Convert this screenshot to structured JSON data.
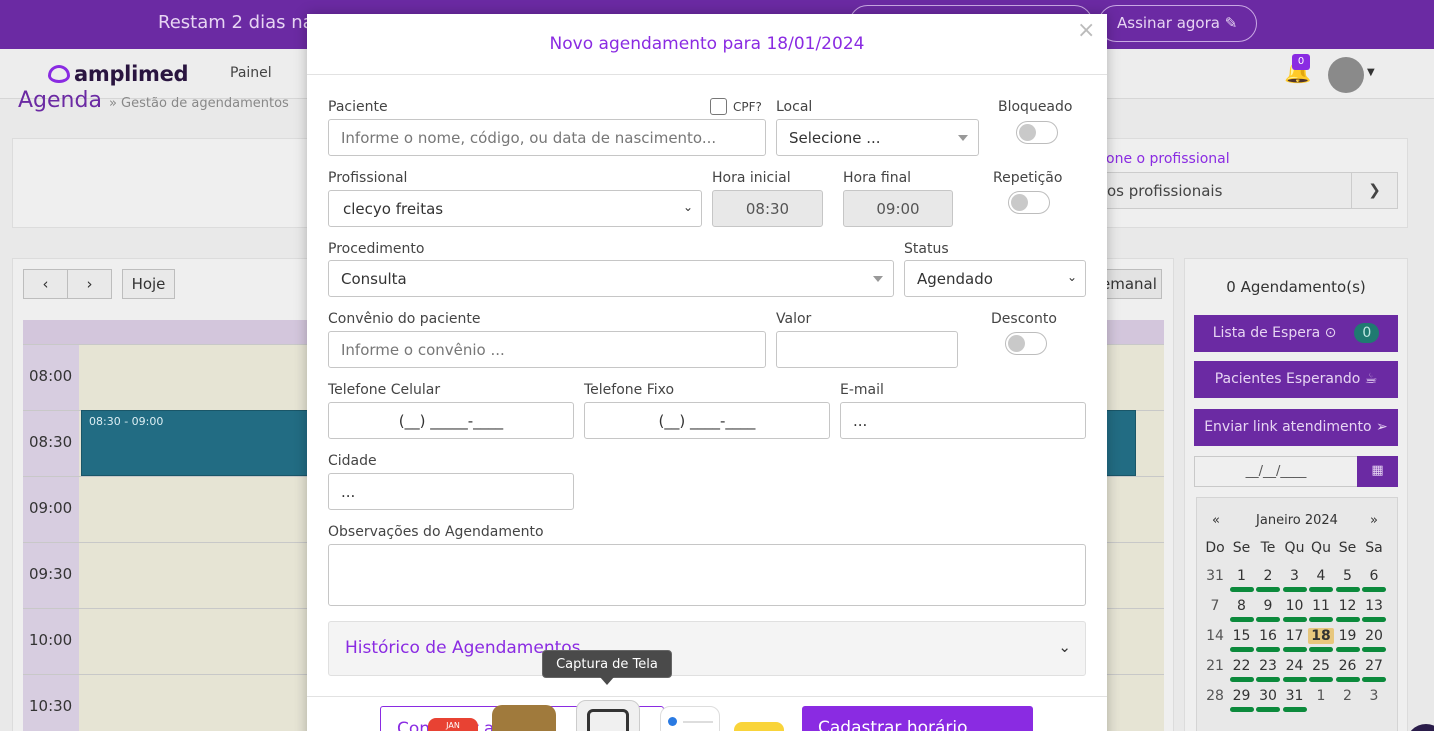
{
  "banner": {
    "trial_text": "Restam 2 dias na",
    "subscribe_label": "Assinar agora ✎",
    "other_label": ""
  },
  "nav": {
    "logo": "amplimed",
    "painel": "Painel",
    "notifications_count": "0"
  },
  "page": {
    "title": "Agenda",
    "subtitle": "» Gestão de agendamentos"
  },
  "filter": {
    "label": "one o profissional",
    "value": "os profissionais"
  },
  "calendar": {
    "prev": "‹",
    "next": "›",
    "today": "Hoje",
    "view": "emanal",
    "times": [
      "08:00",
      "08:30",
      "09:00",
      "09:30",
      "10:00",
      "10:30"
    ],
    "appointment_time": "08:30 - 09:00"
  },
  "sidebar": {
    "count": "0 Agendamento(s)",
    "wait_list": "Lista de Espera ⊙",
    "wait_count": "0",
    "waiting_patients": "Pacientes Esperando ☕",
    "send_link": "Enviar link atendimento ➢",
    "date_placeholder": "__/__/____",
    "mini_cal": {
      "prev": "«",
      "title": "Janeiro 2024",
      "next": "»",
      "weekdays": [
        "Do",
        "Se",
        "Te",
        "Qu",
        "Qu",
        "Se",
        "Sa"
      ],
      "weeks": [
        [
          "31",
          "1",
          "2",
          "3",
          "4",
          "5",
          "6"
        ],
        [
          "7",
          "8",
          "9",
          "10",
          "11",
          "12",
          "13"
        ],
        [
          "14",
          "15",
          "16",
          "17",
          "18",
          "19",
          "20"
        ],
        [
          "21",
          "22",
          "23",
          "24",
          "25",
          "26",
          "27"
        ],
        [
          "28",
          "29",
          "30",
          "31",
          "1",
          "2",
          "3"
        ]
      ],
      "today": "18"
    }
  },
  "modal": {
    "title": "Novo agendamento para 18/01/2024",
    "close": "×",
    "patient_label": "Paciente",
    "cpf_label": "CPF?",
    "patient_placeholder": "Informe o nome, código, ou data de nascimento...",
    "local_label": "Local",
    "local_value": "Selecione ...",
    "blocked_label": "Bloqueado",
    "professional_label": "Profissional",
    "professional_value": "clecyo freitas",
    "start_label": "Hora inicial",
    "start_value": "08:30",
    "end_label": "Hora final",
    "end_value": "09:00",
    "repeat_label": "Repetição",
    "procedure_label": "Procedimento",
    "procedure_value": "Consulta",
    "status_label": "Status",
    "status_value": "Agendado",
    "insurance_label": "Convênio do paciente",
    "insurance_placeholder": "Informe o convênio ...",
    "value_label": "Valor",
    "discount_label": "Desconto",
    "mobile_label": "Telefone Celular",
    "mobile_value": "(__) _____-____",
    "landline_label": "Telefone Fixo",
    "landline_value": "(__) ____-____",
    "email_label": "E-mail",
    "email_value": "...",
    "city_label": "Cidade",
    "city_value": "...",
    "notes_label": "Observações do Agendamento",
    "history_label": "Histórico de Agendamentos",
    "btn_outline": "Consultar agenda",
    "btn_primary": "Cadastrar horário"
  },
  "tooltip": "Captura de Tela",
  "colors": {
    "accent": "#8a2be2",
    "banner": "#6b2aa3",
    "appointment": "#226c83",
    "calendar_bar": "#0c8a3c"
  }
}
